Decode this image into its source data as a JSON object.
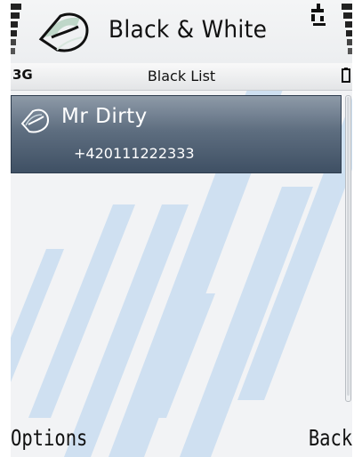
{
  "header": {
    "app_title": "Black & White",
    "logo_icon": "black-white-logo-icon",
    "signal_icon": "signal-strength-icon",
    "battery_level_icon": "battery-level-bars-icon",
    "packet_data_icon": "packet-data-icon"
  },
  "status_bar": {
    "network_type": "3G",
    "title": "Black List",
    "battery_icon": "battery-icon"
  },
  "list": {
    "items": [
      {
        "name": "Mr Dirty",
        "number": "+420111222333",
        "icon": "black-white-logo-icon",
        "selected": true
      }
    ]
  },
  "softkeys": {
    "left": "Options",
    "right": "Back"
  },
  "colors": {
    "selection_top": "#8e9aa8",
    "selection_bottom": "#3f5064",
    "background": "#f2f3f5",
    "stripe": "#c9ddf1",
    "frame": "#4aa3d8"
  }
}
